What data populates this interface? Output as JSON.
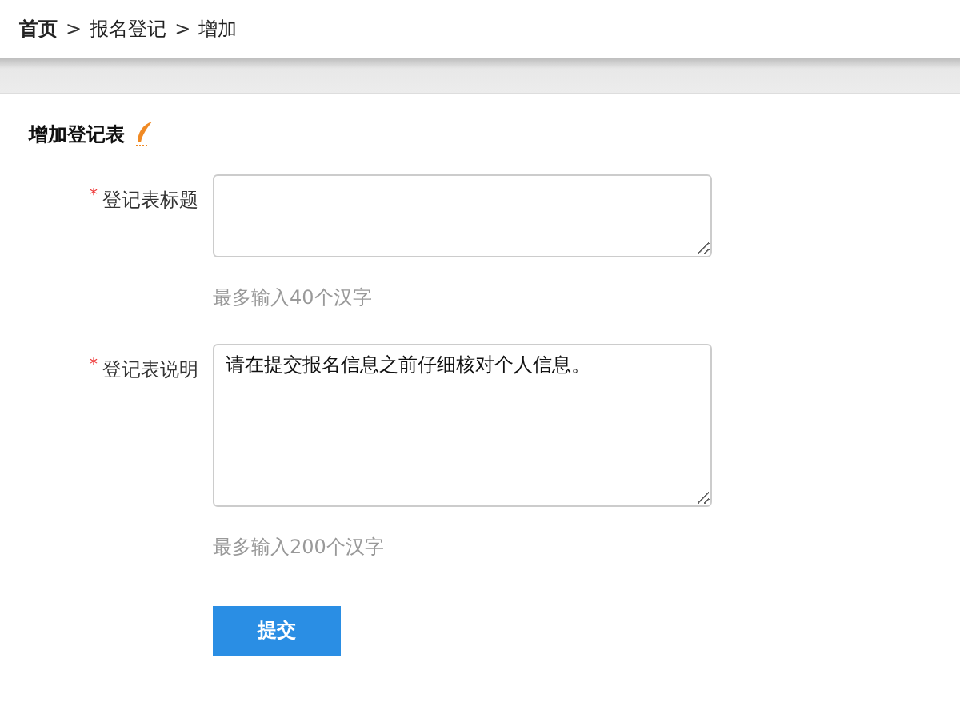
{
  "breadcrumb": [
    {
      "label": "首页"
    },
    {
      "label": ">",
      "kind": "separator"
    },
    {
      "label": "报名登记"
    },
    {
      "label": ">",
      "kind": "separator"
    },
    {
      "label": "增加"
    }
  ],
  "section_title": "增加登记表",
  "fields": [
    {
      "required_mark": "*",
      "label": "登记表标题",
      "hint": "最多输入40个汉字"
    },
    {
      "required_mark": "*",
      "label": "登记表说明",
      "value": "请在提交报名信息之前仔细核对个人信息。",
      "hint": "最多输入200个汉字"
    }
  ],
  "submit_button": "提交"
}
